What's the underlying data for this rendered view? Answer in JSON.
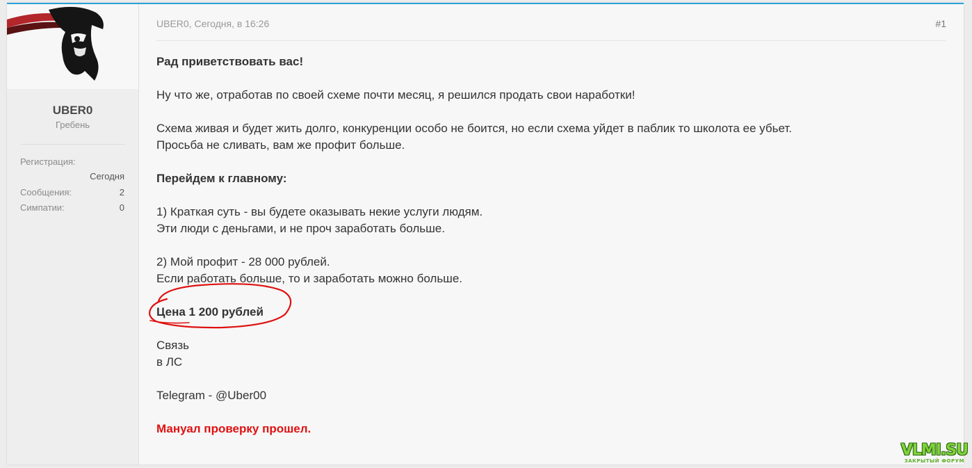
{
  "user": {
    "name": "UBER0",
    "title": "Гребень",
    "stats": [
      {
        "label": "Регистрация:",
        "value": "Сегодня"
      },
      {
        "label": "Сообщения:",
        "value": "2"
      },
      {
        "label": "Симпатии:",
        "value": "0"
      }
    ]
  },
  "post": {
    "meta": "UBER0, Сегодня, в 16:26",
    "number": "#1",
    "lines": {
      "greeting": "Рад приветствовать вас!",
      "p1": "Ну что же, отработав по своей схеме почти месяц, я решился продать свои наработки!",
      "p2a": "Схема живая и будет жить долго, конкуренции особо не боится, но если схема уйдет в паблик то школота ее убьет.",
      "p2b": "Просьба не сливать, вам же профит больше.",
      "main_header": "Перейдем к главному:",
      "p3a": "1) Краткая суть - вы будете оказывать некие услуги людям.",
      "p3b": "Эти люди с деньгами, и не проч заработать больше.",
      "p4a": "2) Мой профит - 28 000 рублей.",
      "p4b": "Если работать больше, то и заработать можно больше.",
      "price": "Цена 1 200 рублей",
      "contact_a": "Связь",
      "contact_b": "в ЛС",
      "telegram": "Telegram - @Uber00",
      "manual": "Мануал проверку прошел."
    }
  },
  "watermark": {
    "main": "VLMI.SU",
    "sub": "ЗАКРЫТЫЙ ФОРУМ"
  },
  "colors": {
    "accent": "#2aa4d8",
    "annotation": "#e01111",
    "watermark": "#7fd23a"
  }
}
